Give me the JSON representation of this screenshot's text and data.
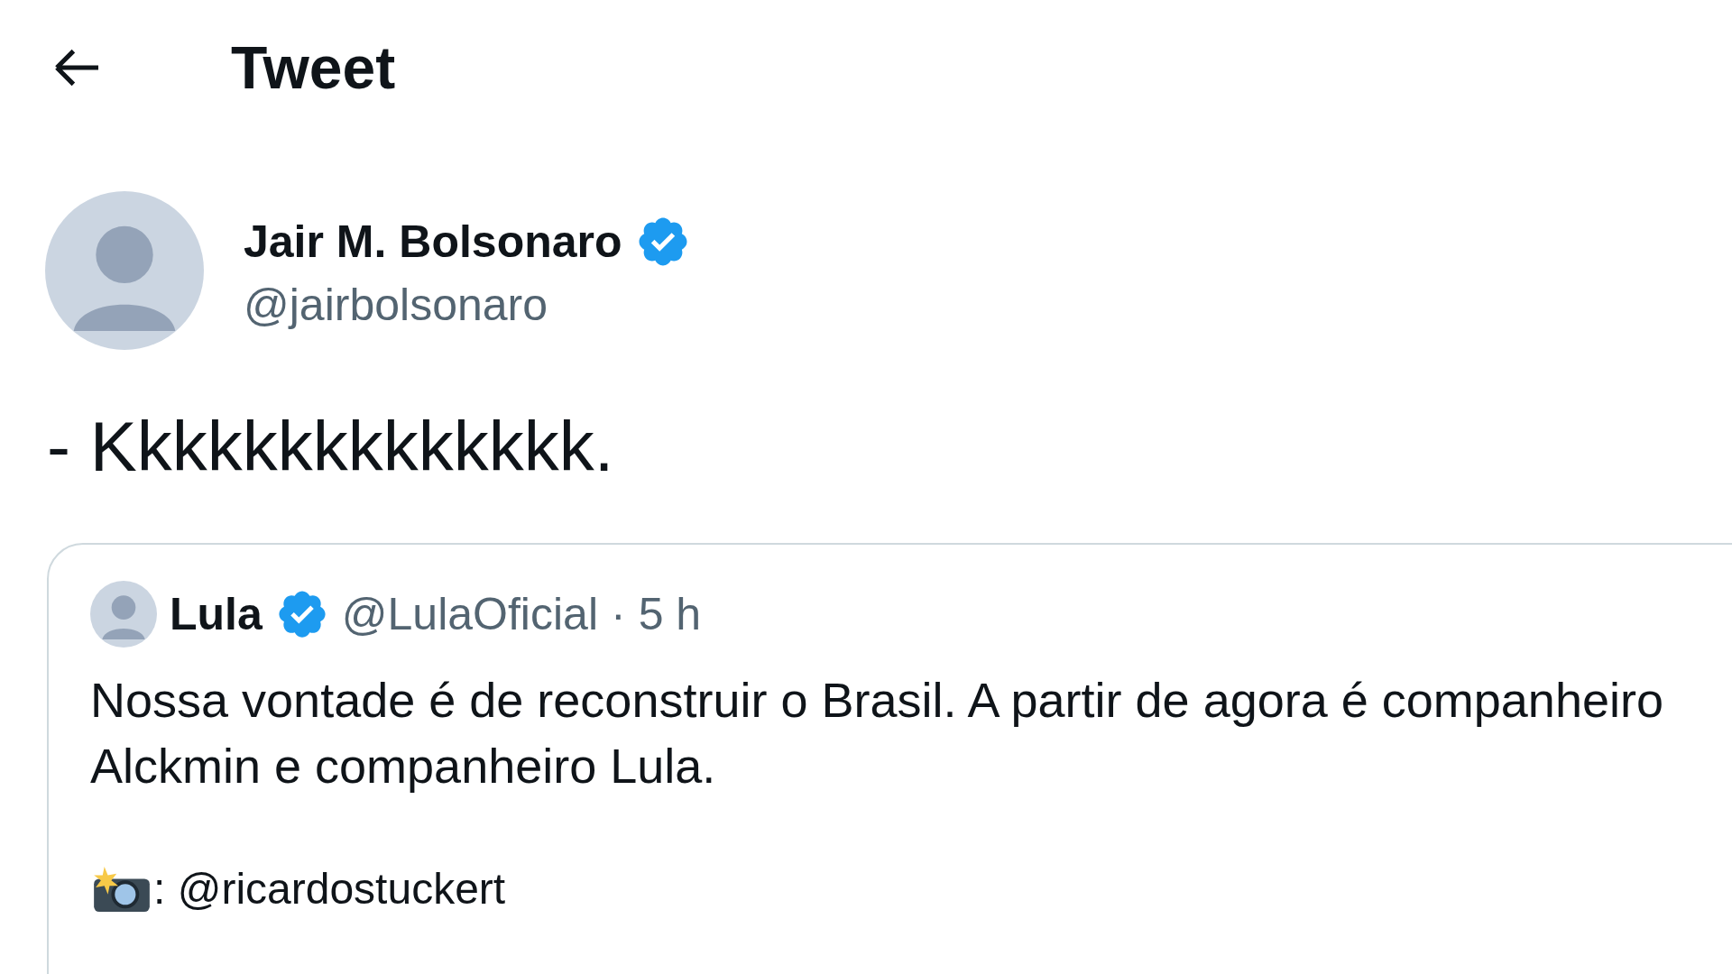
{
  "header": {
    "title": "Tweet"
  },
  "tweet": {
    "name": "Jair M. Bolsonaro",
    "verified": true,
    "handle": "@jairbolsonaro",
    "text": "- Kkkkkkkkkkkkkk.",
    "quote": {
      "name": "Lula",
      "verified": true,
      "handle": "@LulaOficial",
      "separator": "·",
      "time": "5 h",
      "text": "Nossa vontade é de reconstruir o Brasil. A partir de agora é companheiro Alckmin e companheiro Lula.",
      "credit": ": @ricardostuckert"
    }
  }
}
